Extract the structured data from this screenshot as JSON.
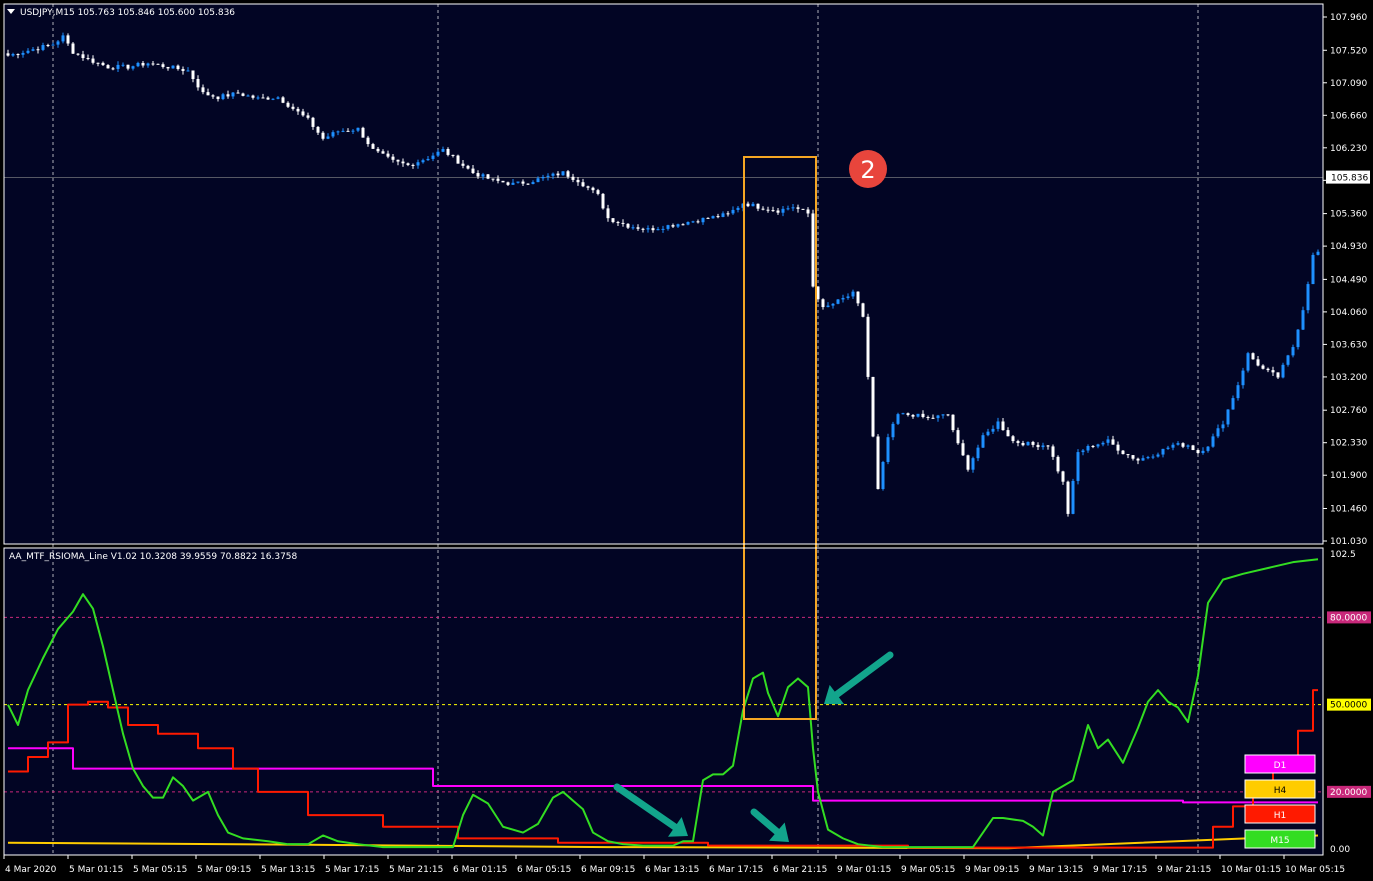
{
  "header": {
    "main_title": "USDJPY,M15",
    "ohlc": "105.763 105.846 105.600 105.836",
    "indicator_title": "AA_MTF_RSIOMA_Line V1.02 10.3208 39.9559 70.8822 16.3758"
  },
  "colors": {
    "background": "#020524",
    "border": "#ffffff",
    "grid": "#ffffff",
    "candle_up": "#1e90ff",
    "candle_down": "#ffffff",
    "m15_line": "#33dd22",
    "h1_line": "#ff1a00",
    "h4_line": "#ffcc00",
    "d1_line": "#ff00ff",
    "level_80": "#c8287a",
    "level_50": "#ffff00",
    "level_20": "#c8287a",
    "highlight_box": "#f5a623",
    "arrow": "#12a58c",
    "badge": "#e8453c"
  },
  "badge_text": "2",
  "price_axis": {
    "labels": [
      "107.960",
      "107.520",
      "107.090",
      "106.660",
      "106.230",
      "105.800",
      "105.360",
      "104.930",
      "104.490",
      "104.060",
      "103.630",
      "103.200",
      "102.760",
      "102.330",
      "101.900",
      "101.460",
      "101.030"
    ],
    "current": "105.836"
  },
  "indicator_axis": {
    "top_label": "102.5",
    "bottom_label": "0.00",
    "level_80": "80.0000",
    "level_50": "50.0000",
    "level_20": "20.0000"
  },
  "legend": [
    {
      "text": "D1",
      "color": "#ff00ff",
      "text_color": "#ffffff"
    },
    {
      "text": "H4",
      "color": "#ffcc00",
      "text_color": "#000000"
    },
    {
      "text": "H1",
      "color": "#ff1a00",
      "text_color": "#ffffff"
    },
    {
      "text": "M15",
      "color": "#33dd22",
      "text_color": "#ffffff"
    }
  ],
  "time_axis": [
    "4 Mar 2020",
    "5 Mar 01:15",
    "5 Mar 05:15",
    "5 Mar 09:15",
    "5 Mar 13:15",
    "5 Mar 17:15",
    "5 Mar 21:15",
    "6 Mar 01:15",
    "6 Mar 05:15",
    "6 Mar 09:15",
    "6 Mar 13:15",
    "6 Mar 17:15",
    "6 Mar 21:15",
    "9 Mar 01:15",
    "9 Mar 05:15",
    "9 Mar 09:15",
    "9 Mar 13:15",
    "9 Mar 17:15",
    "9 Mar 21:15",
    "10 Mar 01:15",
    "10 Mar 05:15"
  ],
  "chart_data": [
    {
      "type": "candlestick",
      "symbol": "USDJPY",
      "timeframe": "M15",
      "ylim": [
        101.03,
        107.96
      ],
      "open": 105.763,
      "high": 105.846,
      "low": 105.6,
      "close": 105.836,
      "close_path": [
        [
          0,
          107.45
        ],
        [
          3,
          107.5
        ],
        [
          6,
          107.55
        ],
        [
          9,
          107.6
        ],
        [
          11,
          107.7
        ],
        [
          13,
          107.5
        ],
        [
          16,
          107.4
        ],
        [
          20,
          107.3
        ],
        [
          24,
          107.3
        ],
        [
          28,
          107.35
        ],
        [
          32,
          107.3
        ],
        [
          36,
          107.25
        ],
        [
          39,
          106.95
        ],
        [
          42,
          106.9
        ],
        [
          46,
          106.95
        ],
        [
          50,
          106.88
        ],
        [
          54,
          106.9
        ],
        [
          57,
          106.75
        ],
        [
          60,
          106.6
        ],
        [
          63,
          106.35
        ],
        [
          66,
          106.45
        ],
        [
          70,
          106.48
        ],
        [
          73,
          106.2
        ],
        [
          77,
          106.05
        ],
        [
          80,
          106.0
        ],
        [
          84,
          106.1
        ],
        [
          87,
          106.2
        ],
        [
          90,
          106.05
        ],
        [
          93,
          105.9
        ],
        [
          97,
          105.8
        ],
        [
          101,
          105.75
        ],
        [
          104,
          105.78
        ],
        [
          108,
          105.85
        ],
        [
          111,
          105.9
        ],
        [
          114,
          105.8
        ],
        [
          118,
          105.6
        ],
        [
          120,
          105.3
        ],
        [
          124,
          105.2
        ],
        [
          128,
          105.15
        ],
        [
          132,
          105.2
        ],
        [
          136,
          105.25
        ],
        [
          140,
          105.3
        ],
        [
          144,
          105.35
        ],
        [
          147,
          105.5
        ],
        [
          150,
          105.45
        ],
        [
          154,
          105.4
        ],
        [
          157,
          105.45
        ],
        [
          160,
          105.36
        ],
        [
          161,
          104.4
        ],
        [
          163,
          104.1
        ],
        [
          166,
          104.2
        ],
        [
          169,
          104.3
        ],
        [
          171,
          104.0
        ],
        [
          173,
          102.4
        ],
        [
          174,
          101.7
        ],
        [
          176,
          102.4
        ],
        [
          178,
          102.7
        ],
        [
          181,
          102.7
        ],
        [
          184,
          102.65
        ],
        [
          188,
          102.7
        ],
        [
          190,
          102.3
        ],
        [
          192,
          102.0
        ],
        [
          195,
          102.4
        ],
        [
          198,
          102.6
        ],
        [
          201,
          102.35
        ],
        [
          205,
          102.3
        ],
        [
          208,
          102.3
        ],
        [
          211,
          101.8
        ],
        [
          212,
          101.4
        ],
        [
          214,
          102.2
        ],
        [
          217,
          102.3
        ],
        [
          220,
          102.35
        ],
        [
          223,
          102.2
        ],
        [
          226,
          102.1
        ],
        [
          230,
          102.2
        ],
        [
          233,
          102.3
        ],
        [
          236,
          102.3
        ],
        [
          238,
          102.2
        ],
        [
          240,
          102.3
        ],
        [
          243,
          102.6
        ],
        [
          246,
          103.1
        ],
        [
          248,
          103.5
        ],
        [
          251,
          103.3
        ],
        [
          254,
          103.2
        ],
        [
          257,
          103.6
        ],
        [
          259,
          104.1
        ],
        [
          261,
          104.8
        ],
        [
          262,
          104.85
        ]
      ],
      "n_bars": 263
    },
    {
      "type": "line",
      "title": "AA_MTF_RSIOMA_Line V1.02",
      "ylim": [
        0,
        102.5
      ],
      "levels": [
        80,
        50,
        20
      ],
      "series": [
        {
          "name": "D1",
          "points": [
            [
              0,
              35
            ],
            [
              12,
              35
            ],
            [
              13,
              28
            ],
            [
              84,
              28
            ],
            [
              85,
              22
            ],
            [
              160,
              22
            ],
            [
              161,
              17
            ],
            [
              234,
              17
            ],
            [
              235,
              16.4
            ],
            [
              262,
              16.4
            ]
          ]
        },
        {
          "name": "H4",
          "points": [
            [
              0,
              2.5
            ],
            [
              60,
              1.8
            ],
            [
              120,
              1
            ],
            [
              160,
              0.8
            ],
            [
              200,
              0.6
            ],
            [
              262,
              5
            ]
          ]
        },
        {
          "name": "H1",
          "points": [
            [
              0,
              27
            ],
            [
              4,
              32
            ],
            [
              8,
              37
            ],
            [
              12,
              50
            ],
            [
              16,
              51
            ],
            [
              20,
              49
            ],
            [
              24,
              43
            ],
            [
              30,
              40
            ],
            [
              38,
              35
            ],
            [
              45,
              28
            ],
            [
              50,
              20
            ],
            [
              60,
              12
            ],
            [
              75,
              8
            ],
            [
              90,
              4
            ],
            [
              110,
              2.5
            ],
            [
              140,
              1.5
            ],
            [
              180,
              0.8
            ],
            [
              237,
              0.8
            ],
            [
              241,
              8
            ],
            [
              245,
              15
            ],
            [
              249,
              20
            ],
            [
              253,
              30
            ],
            [
              258,
              41
            ],
            [
              261,
              55
            ],
            [
              262,
              55
            ]
          ]
        },
        {
          "name": "M15",
          "points": [
            [
              0,
              50
            ],
            [
              2,
              43
            ],
            [
              4,
              55
            ],
            [
              7,
              66
            ],
            [
              10,
              76
            ],
            [
              13,
              82
            ],
            [
              15,
              88
            ],
            [
              17,
              83
            ],
            [
              19,
              70
            ],
            [
              21,
              55
            ],
            [
              23,
              40
            ],
            [
              25,
              28
            ],
            [
              27,
              22
            ],
            [
              29,
              18
            ],
            [
              31,
              18
            ],
            [
              33,
              25
            ],
            [
              35,
              22
            ],
            [
              37,
              17
            ],
            [
              40,
              20
            ],
            [
              42,
              12
            ],
            [
              44,
              6
            ],
            [
              47,
              4
            ],
            [
              52,
              3
            ],
            [
              56,
              2
            ],
            [
              60,
              2
            ],
            [
              63,
              5
            ],
            [
              66,
              3
            ],
            [
              70,
              2
            ],
            [
              75,
              1
            ],
            [
              85,
              1
            ],
            [
              89,
              1
            ],
            [
              91,
              12
            ],
            [
              93,
              19
            ],
            [
              96,
              16
            ],
            [
              99,
              8
            ],
            [
              103,
              6
            ],
            [
              106,
              9
            ],
            [
              109,
              18
            ],
            [
              111,
              20
            ],
            [
              113,
              17
            ],
            [
              115,
              14
            ],
            [
              117,
              6
            ],
            [
              120,
              3
            ],
            [
              123,
              2
            ],
            [
              127,
              1.5
            ],
            [
              133,
              1.5
            ],
            [
              135,
              3
            ],
            [
              137,
              3
            ],
            [
              139,
              24
            ],
            [
              141,
              26
            ],
            [
              143,
              26
            ],
            [
              145,
              29
            ],
            [
              147,
              48
            ],
            [
              149,
              59
            ],
            [
              151,
              61
            ],
            [
              152,
              54
            ],
            [
              154,
              46
            ],
            [
              156,
              56
            ],
            [
              158,
              59
            ],
            [
              160,
              56
            ],
            [
              161,
              35
            ],
            [
              162,
              20
            ],
            [
              164,
              7
            ],
            [
              167,
              4
            ],
            [
              170,
              2
            ],
            [
              175,
              1
            ],
            [
              185,
              1
            ],
            [
              193,
              1
            ],
            [
              195,
              6
            ],
            [
              197,
              11
            ],
            [
              199,
              11
            ],
            [
              203,
              10
            ],
            [
              205,
              8
            ],
            [
              207,
              5
            ],
            [
              209,
              20
            ],
            [
              213,
              24
            ],
            [
              216,
              43
            ],
            [
              218,
              35
            ],
            [
              220,
              38
            ],
            [
              223,
              30
            ],
            [
              226,
              42
            ],
            [
              228,
              51
            ],
            [
              230,
              55
            ],
            [
              232,
              51
            ],
            [
              234,
              49
            ],
            [
              236,
              44
            ],
            [
              238,
              60
            ],
            [
              240,
              85
            ],
            [
              243,
              93
            ],
            [
              247,
              95
            ],
            [
              252,
              97
            ],
            [
              257,
              99
            ],
            [
              262,
              100
            ]
          ]
        }
      ]
    }
  ]
}
